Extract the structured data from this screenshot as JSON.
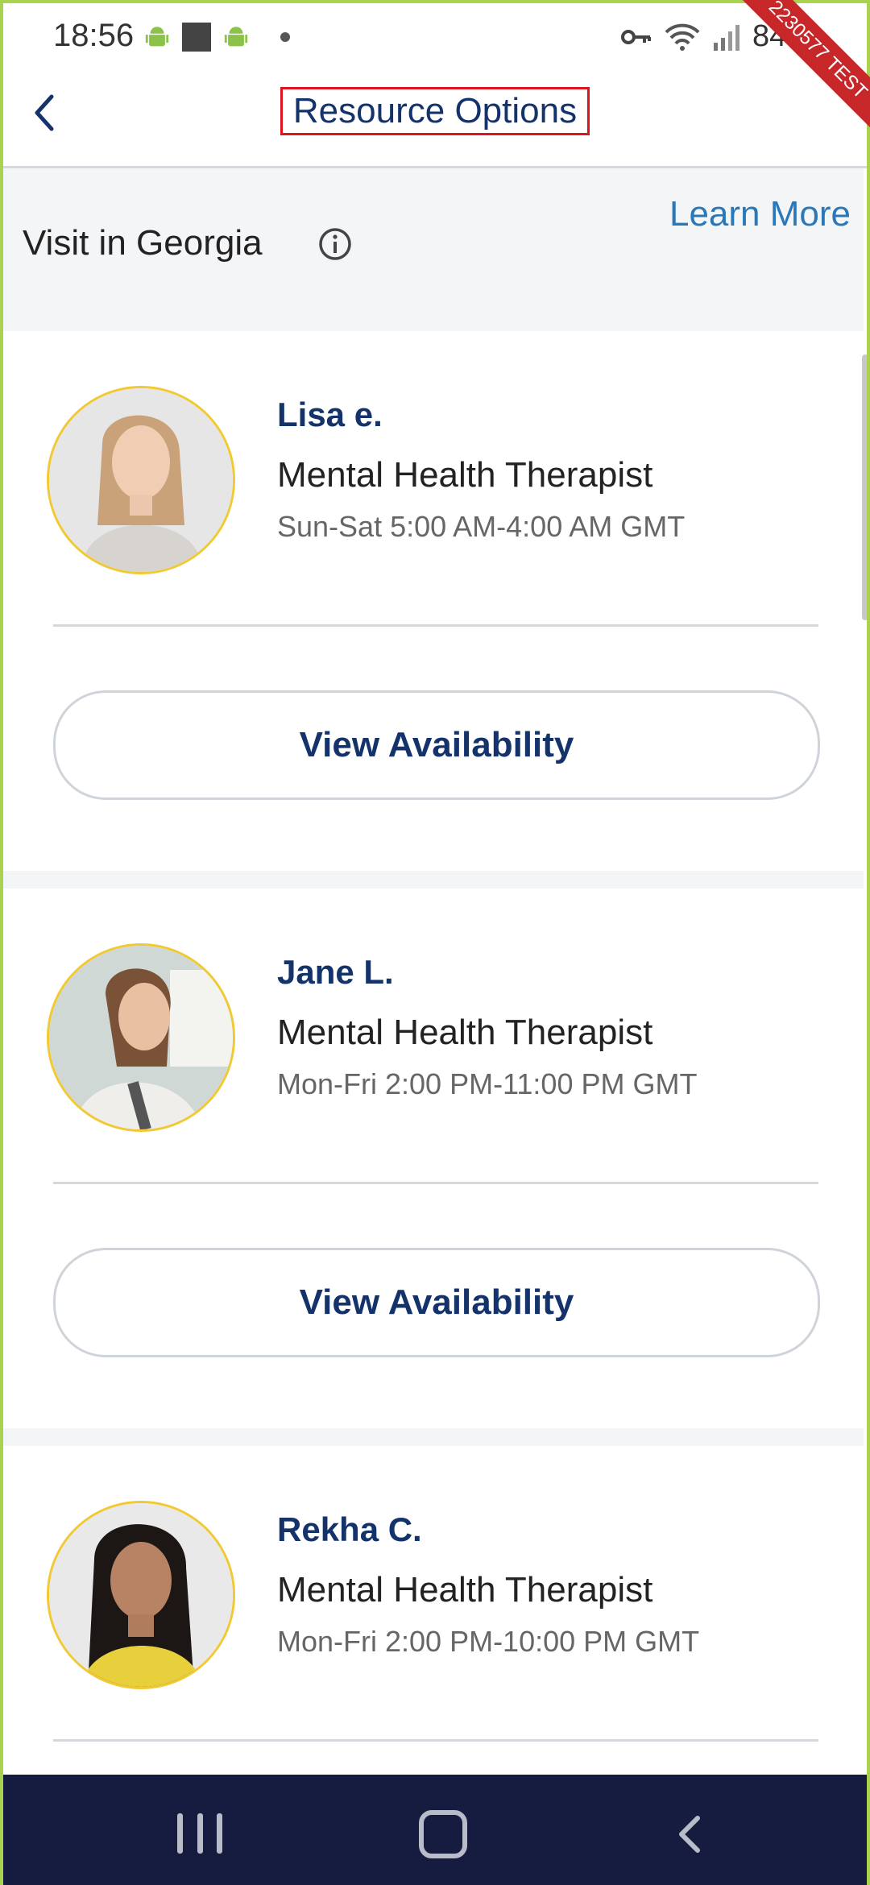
{
  "status_bar": {
    "time": "18:56",
    "battery": "84%",
    "ribbon": "2230577 TEST"
  },
  "header": {
    "title": "Resource Options"
  },
  "visit": {
    "text": "Visit in Georgia",
    "learn_more": "Learn More"
  },
  "providers": [
    {
      "name": "Lisa e.",
      "role": "Mental Health Therapist",
      "hours": "Sun-Sat 5:00 AM-4:00 AM GMT",
      "button": "View Availability"
    },
    {
      "name": "Jane L.",
      "role": "Mental Health Therapist",
      "hours": "Mon-Fri 2:00 PM-11:00 PM GMT",
      "button": "View Availability"
    },
    {
      "name": "Rekha C.",
      "role": "Mental Health Therapist",
      "hours": "Mon-Fri 2:00 PM-10:00 PM GMT"
    }
  ],
  "colors": {
    "accent": "#14336b",
    "link": "#2a78b8",
    "avatar_ring": "#f1c933",
    "navbar": "#151c3f"
  }
}
